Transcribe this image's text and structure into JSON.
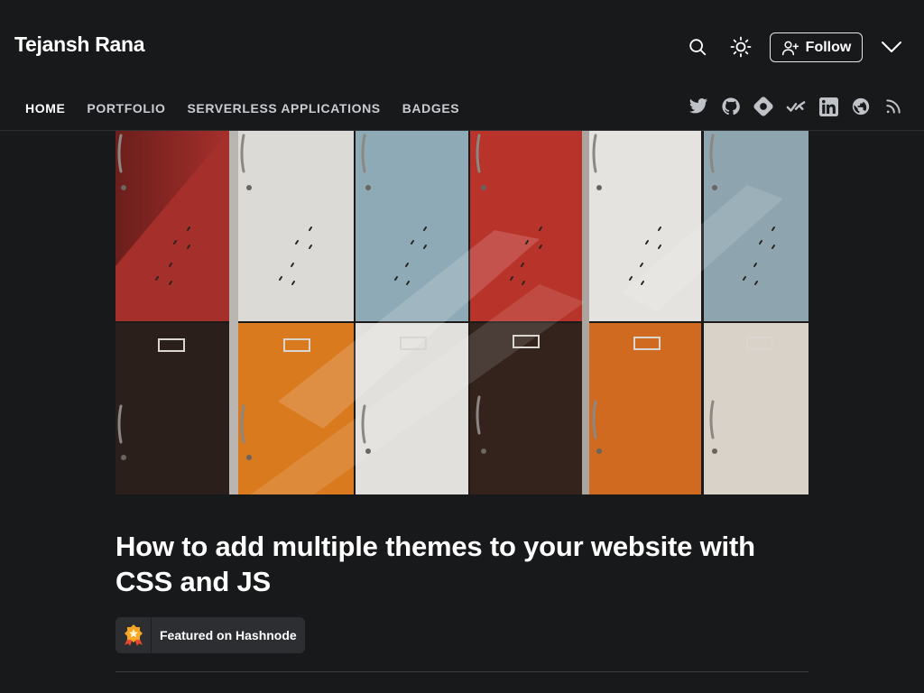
{
  "header": {
    "brand": "Tejansh Rana",
    "follow_label": "Follow"
  },
  "nav": {
    "items": [
      {
        "label": "HOME",
        "active": true
      },
      {
        "label": "PORTFOLIO"
      },
      {
        "label": "SERVERLESS APPLICATIONS"
      },
      {
        "label": "BADGES"
      }
    ]
  },
  "socials": [
    "twitter-icon",
    "github-icon",
    "hashnode-icon",
    "devto-icon",
    "linkedin-icon",
    "website-icon",
    "rss-icon"
  ],
  "post": {
    "title": "How to add multiple themes to your website with CSS and JS",
    "featured_label": "Featured on Hashnode"
  },
  "colors": {
    "background": "#18191b",
    "text": "#ffffff",
    "muted": "#c9ccd1",
    "badge_bg": "#2c2e31",
    "locker_red": "#a52f2b",
    "locker_white": "#dcdad6",
    "locker_blue": "#8eaab6",
    "locker_orange": "#d97a1f",
    "locker_black": "#2b1f1b"
  }
}
